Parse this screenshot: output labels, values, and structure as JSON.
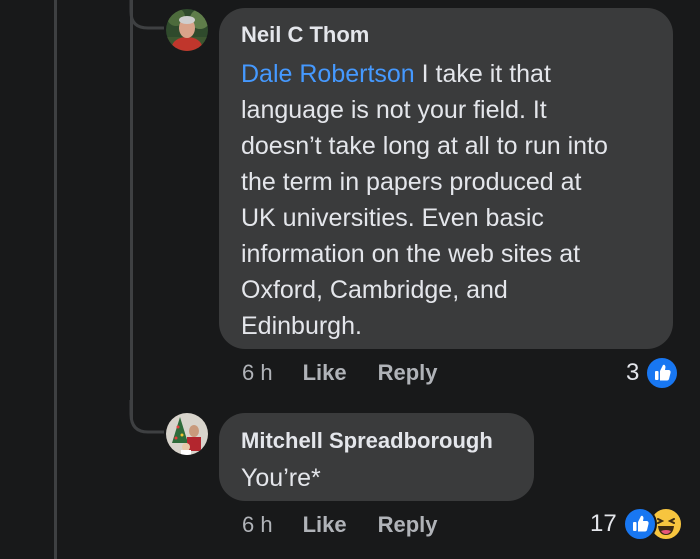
{
  "comments": [
    {
      "author": "Neil C Thom",
      "mention": "Dale Robertson",
      "lines": [
        " I take it that",
        "language is not your field. It",
        "doesn’t take long at all to run into",
        "the term in papers produced at",
        "UK universities. Even basic",
        "information on the web sites at",
        "Oxford, Cambridge, and",
        "Edinburgh."
      ],
      "time": "6 h",
      "like_label": "Like",
      "reply_label": "Reply",
      "reaction_count": "3",
      "reaction_icons": [
        "like-icon"
      ]
    },
    {
      "author": "Mitchell Spreadborough",
      "text": "You’re*",
      "time": "6 h",
      "like_label": "Like",
      "reply_label": "Reply",
      "reaction_count": "17",
      "reaction_icons": [
        "like-icon",
        "haha-emoji-icon"
      ]
    }
  ],
  "colors": {
    "background": "#18191a",
    "bubble": "#3a3b3c",
    "text": "#e4e6eb",
    "secondary_text": "#b0b3b8",
    "mention": "#4599ff",
    "like_blue": "#1877f2"
  }
}
